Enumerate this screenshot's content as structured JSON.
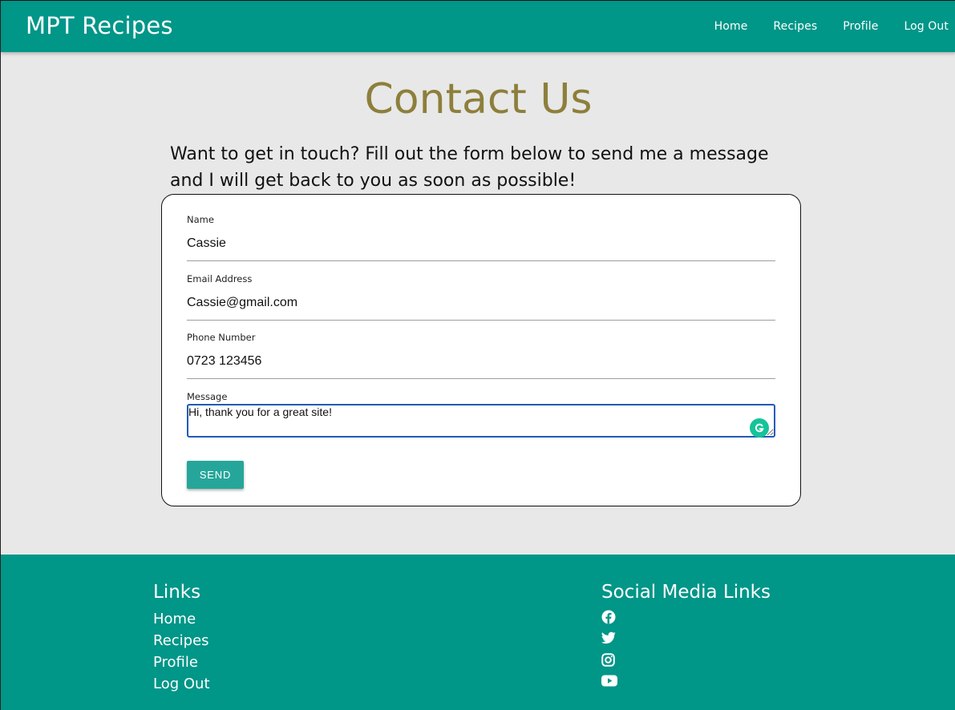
{
  "header": {
    "brand": "MPT Recipes",
    "nav": [
      "Home",
      "Recipes",
      "Profile",
      "Log Out"
    ]
  },
  "main": {
    "title": "Contact Us",
    "intro": "Want to get in touch? Fill out the form below to send me a message and I will get back to you as soon as possible!"
  },
  "form": {
    "name_label": "Name",
    "name_value": "Cassie",
    "email_label": "Email Address",
    "email_value": "Cassie@gmail.com",
    "phone_label": "Phone Number",
    "phone_value": "0723 123456",
    "message_label": "Message",
    "message_value": "Hi, thank you for a great site!",
    "send_label": "SEND"
  },
  "footer": {
    "links_heading": "Links",
    "links": [
      "Home",
      "Recipes",
      "Profile",
      "Log Out"
    ],
    "social_heading": "Social Media Links",
    "social_icons": [
      "facebook-icon",
      "twitter-icon",
      "instagram-icon",
      "youtube-icon"
    ]
  },
  "colors": {
    "primary": "#009688",
    "button": "#26a69a",
    "title": "#8d7f3b",
    "background": "#e8e8e8"
  }
}
